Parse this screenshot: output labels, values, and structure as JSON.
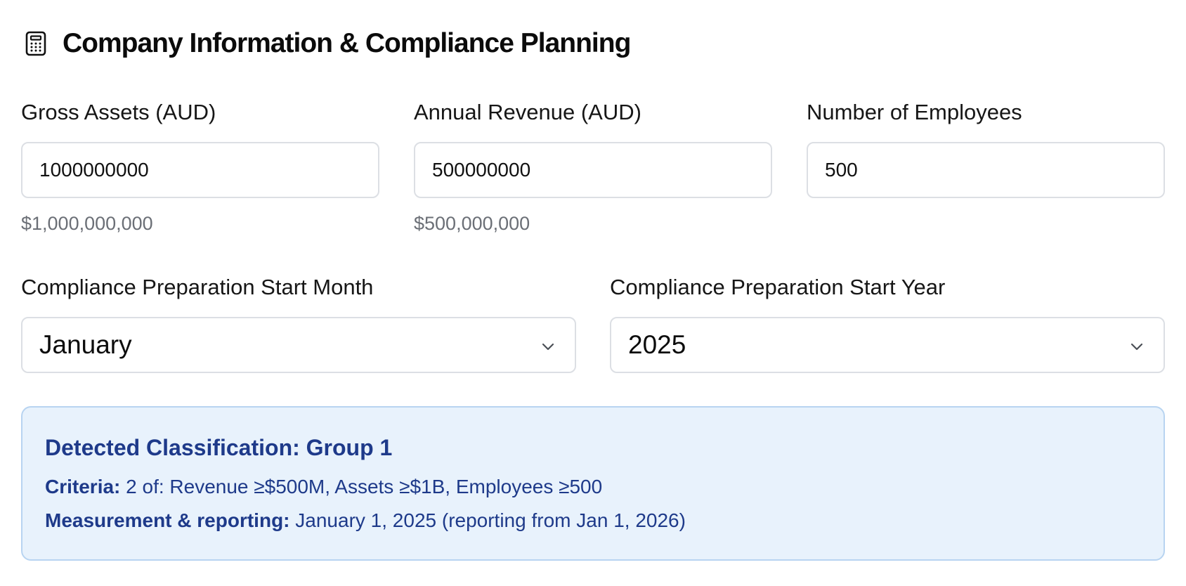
{
  "header": {
    "icon": "calculator-icon",
    "title": "Company Information & Compliance Planning"
  },
  "fields": {
    "gross_assets": {
      "label": "Gross Assets (AUD)",
      "value": "1000000000",
      "formatted": "$1,000,000,000"
    },
    "annual_revenue": {
      "label": "Annual Revenue (AUD)",
      "value": "500000000",
      "formatted": "$500,000,000"
    },
    "employees": {
      "label": "Number of Employees",
      "value": "500"
    },
    "start_month": {
      "label": "Compliance Preparation Start Month",
      "selected": "January"
    },
    "start_year": {
      "label": "Compliance Preparation Start Year",
      "selected": "2025"
    }
  },
  "classification": {
    "title": "Detected Classification: Group 1",
    "criteria_label": "Criteria:",
    "criteria_text": " 2 of: Revenue ≥$500M, Assets ≥$1B, Employees ≥500",
    "measurement_label": "Measurement & reporting:",
    "measurement_text": " January 1, 2025 (reporting from Jan 1, 2026)"
  },
  "colors": {
    "panel_background": "#e8f2fc",
    "panel_border": "#b8d4f1",
    "panel_text": "#1e3a8a",
    "helper_text": "#6b6f76",
    "input_border": "#dcdfe4"
  }
}
